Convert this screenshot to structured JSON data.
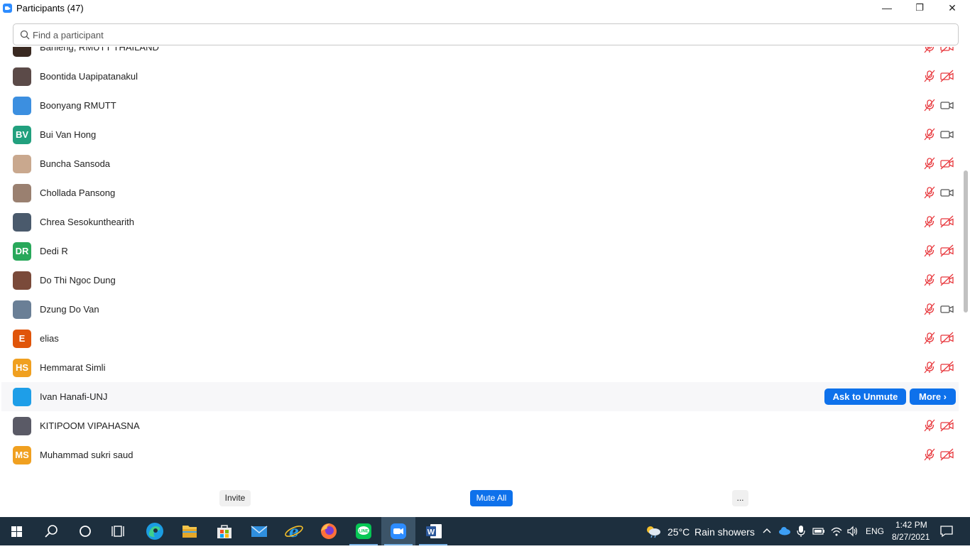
{
  "window": {
    "title": "Participants (47)",
    "minimize": "—",
    "restore": "❐",
    "close": "✕"
  },
  "search": {
    "placeholder": "Find a participant"
  },
  "participants": [
    {
      "name": "Banleng, RMUTT THAILAND",
      "initials": "",
      "color": "#3a2a22",
      "mic": "muted",
      "video": "off"
    },
    {
      "name": "Boontida Uapipatanakul",
      "initials": "",
      "color": "#5b4a48",
      "mic": "muted",
      "video": "off"
    },
    {
      "name": "Boonyang RMUTT",
      "initials": "",
      "color": "#3c8fe0",
      "mic": "muted",
      "video": "on"
    },
    {
      "name": "Bui Van Hong",
      "initials": "BV",
      "color": "#21a07e",
      "mic": "muted",
      "video": "on"
    },
    {
      "name": "Buncha Sansoda",
      "initials": "",
      "color": "#c9a88e",
      "mic": "muted",
      "video": "off"
    },
    {
      "name": "Chollada Pansong",
      "initials": "",
      "color": "#9a8070",
      "mic": "muted",
      "video": "on"
    },
    {
      "name": "Chrea Sesokunthearith",
      "initials": "",
      "color": "#4a5a6c",
      "mic": "muted",
      "video": "off"
    },
    {
      "name": "Dedi R",
      "initials": "DR",
      "color": "#28a85a",
      "mic": "muted",
      "video": "off"
    },
    {
      "name": "Do Thi Ngoc Dung",
      "initials": "",
      "color": "#7a4a3a",
      "mic": "muted",
      "video": "off"
    },
    {
      "name": "Dzung Do Van",
      "initials": "",
      "color": "#6a7f96",
      "mic": "muted",
      "video": "on"
    },
    {
      "name": "elias",
      "initials": "E",
      "color": "#e0550a",
      "mic": "muted",
      "video": "off"
    },
    {
      "name": "Hemmarat Simli",
      "initials": "HS",
      "color": "#f0a020",
      "mic": "muted",
      "video": "off"
    },
    {
      "name": "Ivan Hanafi-UNJ",
      "initials": "",
      "color": "#1e9ee8",
      "mic": "none",
      "video": "none"
    },
    {
      "name": "KITIPOOM VIPAHASNA",
      "initials": "",
      "color": "#5a5a66",
      "mic": "muted",
      "video": "off"
    },
    {
      "name": "Muhammad sukri saud",
      "initials": "MS",
      "color": "#f0a020",
      "mic": "muted",
      "video": "off"
    }
  ],
  "hover_actions": {
    "ask_to_unmute": "Ask to Unmute",
    "more": "More ›"
  },
  "footer": {
    "invite": "Invite",
    "mute_all": "Mute All",
    "more": "..."
  },
  "taskbar": {
    "weather_temp": "25°C",
    "weather_desc": "Rain showers",
    "language": "ENG",
    "time": "1:42 PM",
    "date": "8/27/2021"
  },
  "colors": {
    "accent": "#0e71eb",
    "muted_red": "#e8383d",
    "taskbar": "#1d2f3e"
  }
}
